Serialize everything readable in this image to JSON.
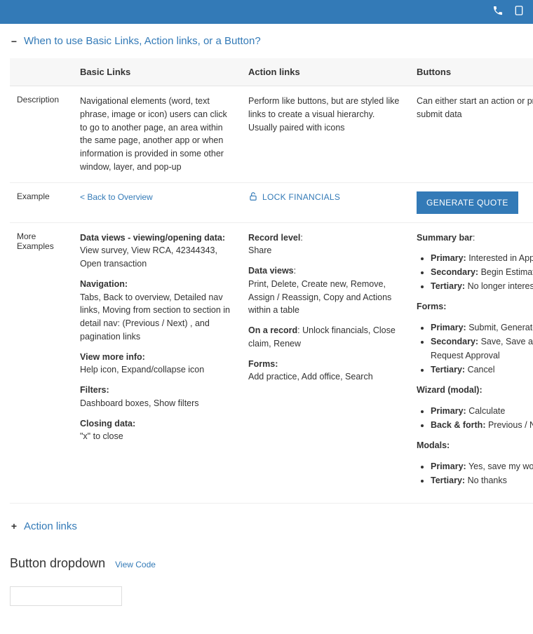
{
  "topbar": {
    "phone_icon": "phone",
    "expand_icon": "expand"
  },
  "accordion1": {
    "toggle": "−",
    "title": "When to use Basic Links, Action links, or a Button?"
  },
  "table": {
    "headers": {
      "blank": "",
      "col1": "Basic Links",
      "col2": "Action links",
      "col3": "Buttons"
    },
    "rows": {
      "description": {
        "label": "Description",
        "basic": "Navigational elements (word, text phrase, image or icon) users can click to go to another page, an area within the same page, another app or when information is provided in some other window, layer, and pop-up",
        "action": "Perform like buttons, but are styled like links to create a visual hierarchy. Usually paired with icons",
        "buttons": "Can either start an action or process or submit data"
      },
      "example": {
        "label": "Example",
        "basic_link": "< Back to Overview",
        "action_link": "LOCK FINANCIALS",
        "button_label": "GENERATE QUOTE"
      },
      "more": {
        "label": "More Examples",
        "basic": {
          "g1_head": "Data views - viewing/opening data:",
          "g1_body": "View survey, View RCA, 42344343, Open transaction",
          "g2_head": "Navigation:",
          "g2_body": "Tabs, Back to overview, Detailed nav links, Moving from section to section in detail nav: (Previous / Next) , and pagination links",
          "g3_head": "View more info:",
          "g3_body": "Help icon, Expand/collapse icon",
          "g4_head": "Filters:",
          "g4_body": "Dashboard boxes, Show filters",
          "g5_head": "Closing data:",
          "g5_body": "\"x\" to close"
        },
        "action": {
          "l1_head": "Record level",
          "l1_body": "Share",
          "l2_head": "Data views",
          "l2_body": "Print, Delete, Create new, Remove, Assign / Reassign, Copy and Actions within a table",
          "l3_head": "On a record",
          "l3_body": "Unlock financials, Close claim, Renew",
          "l4_head": "Forms:",
          "l4_body": "Add practice, Add office, Search"
        },
        "buttons": {
          "sb_head": "Summary bar",
          "sb_primary_k": "Primary:",
          "sb_primary_v": " Interested in Application",
          "sb_secondary_k": "Secondary:",
          "sb_secondary_v": " Begin Estimate",
          "sb_tertiary_k": "Tertiary:",
          "sb_tertiary_v": " No longer interested",
          "fm_head": "Forms:",
          "fm_primary_k": "Primary:",
          "fm_primary_v": " Submit, Generate Quote",
          "fm_secondary_k": "Secondary:",
          "fm_secondary_v": " Save, Save as Draft, Request Approval",
          "fm_tertiary_k": "Tertiary:",
          "fm_tertiary_v": " Cancel",
          "wz_head": "Wizard (modal):",
          "wz_primary_k": "Primary:",
          "wz_primary_v": " Calculate",
          "wz_back_k": "Back & forth:",
          "wz_back_v": " Previous / Next",
          "md_head": "Modals:",
          "md_primary_k": "Primary:",
          "md_primary_v": " Yes, save my work",
          "md_tertiary_k": "Tertiary:",
          "md_tertiary_v": " No thanks"
        }
      }
    }
  },
  "accordion2": {
    "toggle": "+",
    "title": "Action links"
  },
  "section": {
    "title": "Button dropdown",
    "view_code": "View Code"
  }
}
